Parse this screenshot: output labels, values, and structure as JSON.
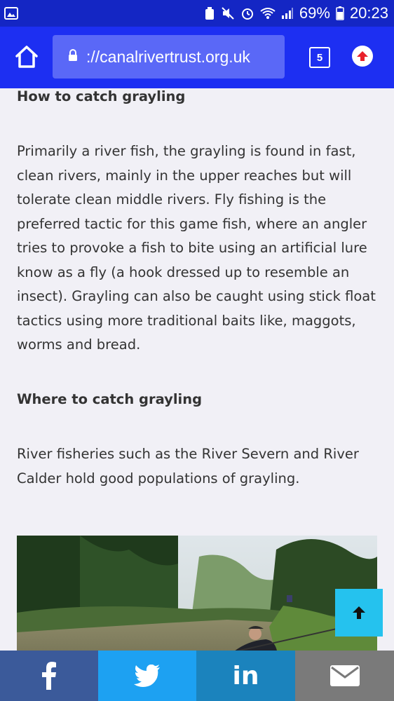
{
  "status_bar": {
    "battery_percent": "69%",
    "time": "20:23"
  },
  "browser": {
    "url": "://canalrivertrust.org.uk",
    "tab_count": "5"
  },
  "article": {
    "heading_how": "How to catch grayling",
    "paragraph_how": "Primarily a river fish, the grayling is found in fast, clean rivers, mainly in the upper reaches but will tolerate clean middle rivers. Fly fishing is the preferred tactic for this game fish, where an angler tries to provoke a fish to bite using an artificial lure know as a fly (a hook dressed up to resemble an insect). Grayling can also be caught using stick float tactics using more traditional baits like, maggots, worms and bread.",
    "heading_where": "Where to catch grayling",
    "paragraph_where": "River fisheries such as the River Severn and River Calder hold good populations of grayling."
  },
  "share_bar": {
    "facebook_color": "#3b5a9a",
    "twitter_color": "#1da1f2",
    "linkedin_color": "#1b83bd",
    "email_color": "#7a7a7a",
    "linkedin_label": "in"
  },
  "icons": {
    "home": "home-icon",
    "lock": "lock-icon",
    "update": "update-arrow-icon",
    "back_to_top": "arrow-up-icon"
  }
}
